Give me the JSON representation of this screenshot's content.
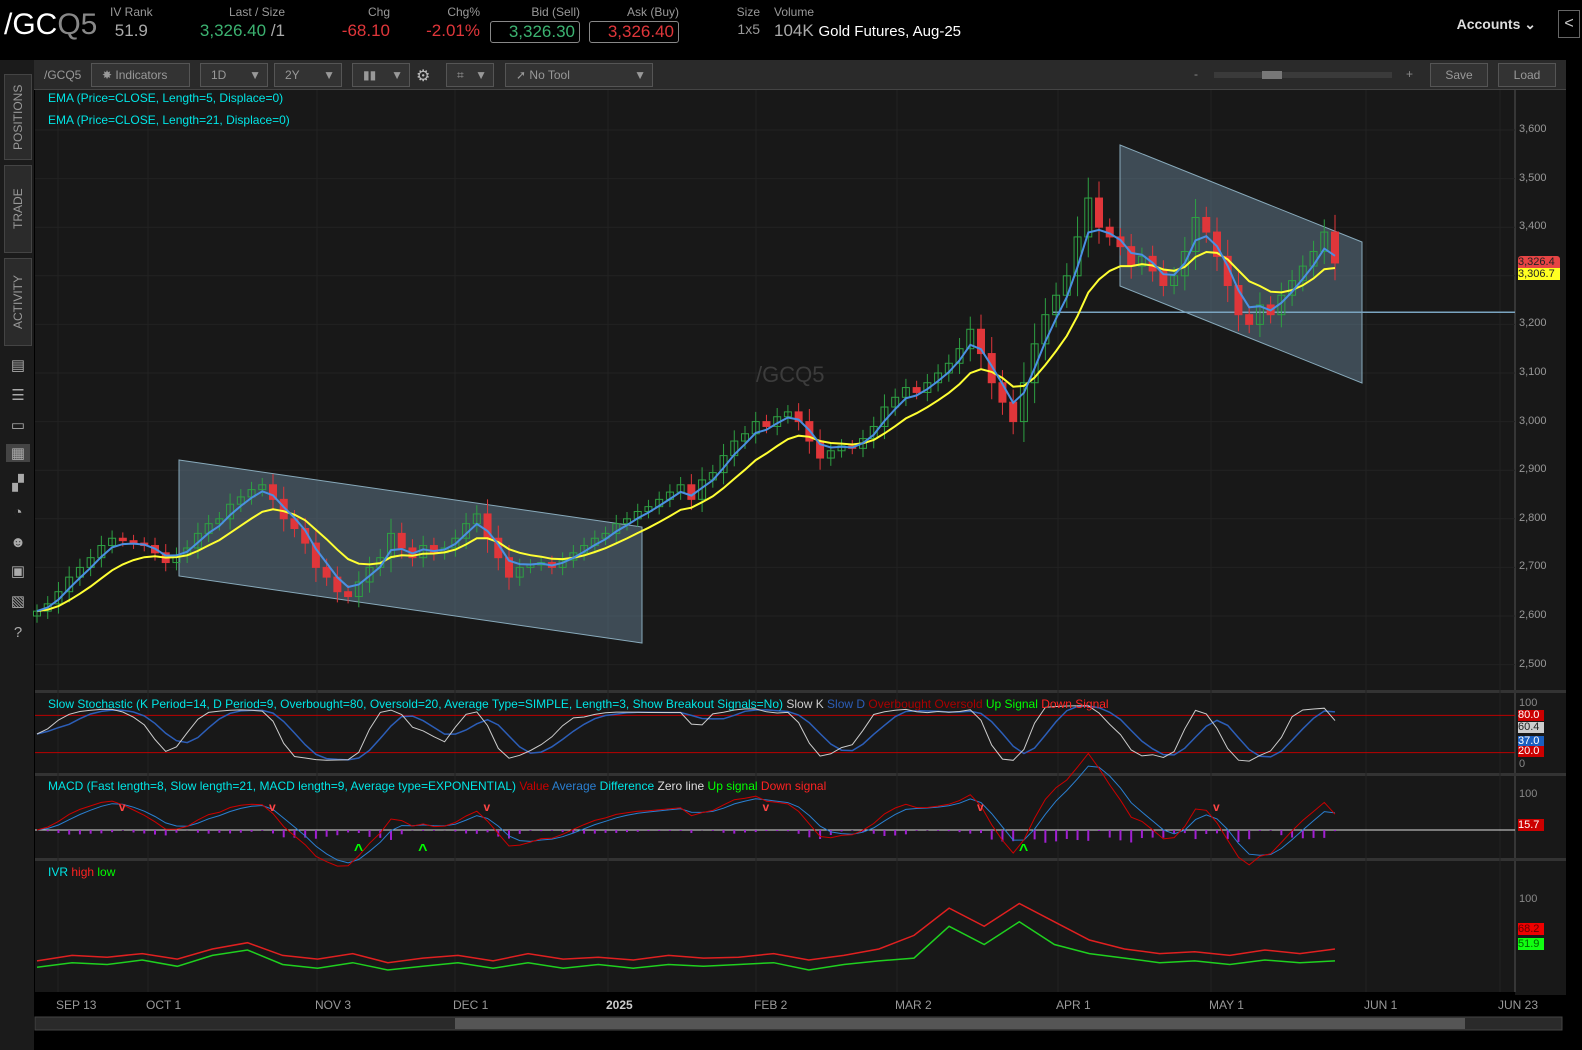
{
  "header": {
    "symbol_a": "/GC",
    "symbol_b": "Q5",
    "iv_rank_label": "IV Rank",
    "iv_rank": "51.9",
    "last_label": "Last / Size",
    "last": "3,326.40",
    "last_size": "/1",
    "chg_label": "Chg",
    "chg": "-68.10",
    "chgp_label": "Chg%",
    "chgp": "-2.01%",
    "bid_label": "Bid (Sell)",
    "bid": "3,326.30",
    "ask_label": "Ask (Buy)",
    "ask": "3,326.40",
    "size_label": "Size",
    "size": "1x5",
    "volume_label": "Volume",
    "volume": "104K",
    "description": "Gold Futures, Aug-25",
    "accounts": "Accounts"
  },
  "toolbar": {
    "symbol": "/GCQ5",
    "indicators": "Indicators",
    "aggregation": "1D",
    "period": "2Y",
    "tool": "No Tool",
    "zoom_minus": "-",
    "zoom_plus": "+",
    "save": "Save",
    "load": "Load"
  },
  "sidebar": {
    "tabs": [
      "POSITIONS",
      "TRADE",
      "ACTIVITY"
    ]
  },
  "chart": {
    "watermark": "/GCQ5",
    "study1": "EMA (Price=CLOSE, Length=5, Displace=0)",
    "study2": "EMA (Price=CLOSE, Length=21, Displace=0)",
    "price_ticks": [
      3600,
      3500,
      3400,
      3300,
      3200,
      3100,
      3000,
      2900,
      2800,
      2700,
      2600,
      2500
    ],
    "price_tick_labels": [
      "3,600",
      "3,500",
      "3,400",
      "3,300",
      "3,200",
      "3,100",
      "3,000",
      "2,900",
      "2,800",
      "2,700",
      "2,600",
      "2,500"
    ],
    "last_price_tag": "3,326.4",
    "ema_tag": "3,306.7",
    "support_level": 3225,
    "date_labels": [
      "SEP 13",
      "OCT 1",
      "NOV 3",
      "DEC 1",
      "2025",
      "FEB 2",
      "MAR 2",
      "APR 1",
      "MAY 1",
      "JUN 1",
      "JUN 23"
    ],
    "colors": {
      "up": "#2ea043",
      "down": "#e0363a",
      "ema5": "#4a90e2",
      "ema21": "#ffff33",
      "channel": "#6c8aa0"
    }
  },
  "stochastic": {
    "label": "Slow Stochastic (K Period=14, D Period=9, Overbought=80, Oversold=20, Average Type=SIMPLE, Length=3, Show Breakout Signals=No)",
    "legend": [
      "Slow K",
      "Slow D",
      "Overbought",
      "Oversold",
      "Up Signal",
      "Down Signal"
    ],
    "axis": [
      "100",
      "0"
    ],
    "tags": [
      "80.0",
      "60.4",
      "37.0",
      "20.0"
    ]
  },
  "macd": {
    "label": "MACD (Fast length=8, Slow length=21, MACD length=9, Average type=EXPONENTIAL)",
    "legend": [
      "Value",
      "Average",
      "Difference",
      "Zero line",
      "Up signal",
      "Down signal"
    ],
    "axis": "100",
    "tag": "15.7"
  },
  "ivr": {
    "label": "IVR",
    "legend": [
      "high",
      "low"
    ],
    "axis": "100",
    "tags": [
      "68.2",
      "51.9"
    ],
    "high": [
      32,
      38,
      36,
      40,
      34,
      45,
      52,
      38,
      34,
      40,
      30,
      35,
      38,
      32,
      40,
      34,
      36,
      33,
      38,
      35,
      36,
      40,
      33,
      38,
      45,
      60,
      90,
      70,
      95,
      75,
      55,
      45,
      40,
      42,
      38,
      44,
      40,
      45
    ],
    "low": [
      25,
      30,
      28,
      33,
      26,
      38,
      44,
      28,
      24,
      30,
      22,
      26,
      30,
      24,
      30,
      24,
      28,
      24,
      28,
      26,
      28,
      30,
      22,
      28,
      32,
      35,
      70,
      50,
      75,
      50,
      40,
      35,
      30,
      32,
      28,
      33,
      30,
      32
    ]
  },
  "chart_data": {
    "type": "candlestick",
    "title": "/GCQ5 Gold Futures, Aug-25",
    "ylim": [
      2450,
      3650
    ],
    "closes": [
      2610,
      2625,
      2650,
      2680,
      2700,
      2720,
      2745,
      2760,
      2755,
      2750,
      2745,
      2730,
      2710,
      2725,
      2740,
      2770,
      2790,
      2800,
      2830,
      2845,
      2860,
      2870,
      2840,
      2800,
      2780,
      2750,
      2700,
      2680,
      2650,
      2640,
      2670,
      2700,
      2720,
      2770,
      2740,
      2720,
      2745,
      2730,
      2740,
      2760,
      2790,
      2810,
      2760,
      2720,
      2680,
      2700,
      2705,
      2710,
      2700,
      2715,
      2730,
      2745,
      2760,
      2770,
      2790,
      2800,
      2815,
      2825,
      2840,
      2855,
      2870,
      2840,
      2880,
      2895,
      2930,
      2960,
      2975,
      3000,
      2990,
      3010,
      3020,
      3000,
      2960,
      2925,
      2940,
      2950,
      2945,
      2965,
      2990,
      3030,
      3050,
      3070,
      3060,
      3080,
      3100,
      3120,
      3150,
      3190,
      3140,
      3080,
      3040,
      3000,
      3080,
      3160,
      3220,
      3260,
      3300,
      3380,
      3460,
      3400,
      3380,
      3360,
      3320,
      3340,
      3310,
      3280,
      3300,
      3350,
      3420,
      3390,
      3340,
      3280,
      3220,
      3200,
      3240,
      3220,
      3260,
      3290,
      3320,
      3350,
      3390,
      3326.4
    ]
  }
}
